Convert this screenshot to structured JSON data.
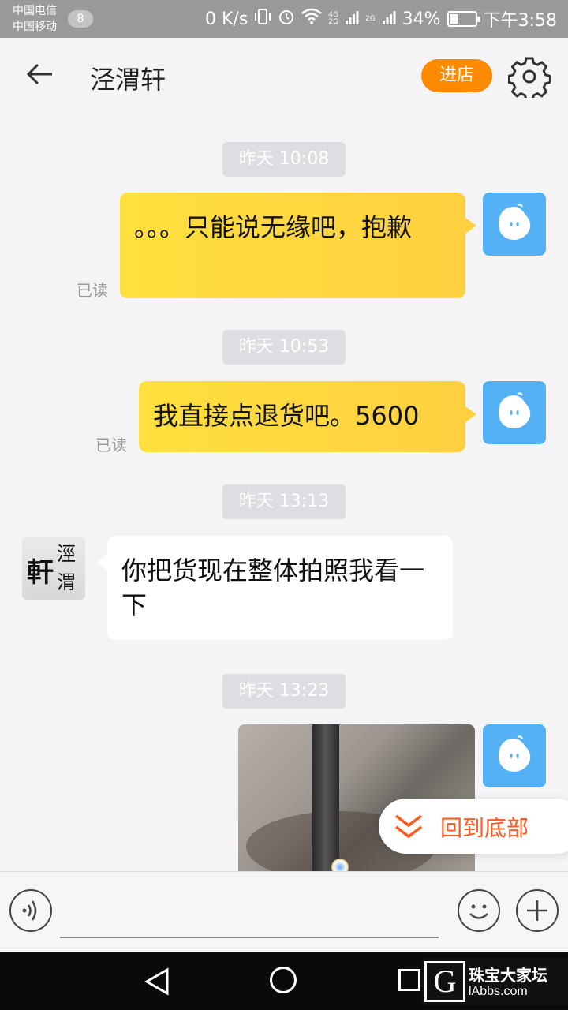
{
  "status_bar": {
    "carrier1": "中国电信",
    "carrier2": "中国移动",
    "notification_count": "8",
    "network_speed": "0 K/s",
    "net_4g": "4G",
    "net_2g_a": "2G",
    "net_2g_b": "2G",
    "battery_percent": "34%",
    "battery_level": 0.34,
    "time": "下午3:58"
  },
  "header": {
    "title": "泾渭轩",
    "enter_store_label": "进店"
  },
  "messages": [
    {
      "type": "time",
      "text": "昨天 10:08"
    },
    {
      "type": "mine",
      "text": "。。。只能说无缘吧，抱歉",
      "read": "已读"
    },
    {
      "type": "time",
      "text": "昨天 10:53"
    },
    {
      "type": "mine",
      "text": "我直接点退货吧。5600",
      "read": "已读"
    },
    {
      "type": "time",
      "text": "昨天 13:13"
    },
    {
      "type": "theirs",
      "text": "你把货现在整体拍照我看一下"
    },
    {
      "type": "time",
      "text": "昨天 13:23"
    },
    {
      "type": "mine_image"
    }
  ],
  "shop_avatar_text": {
    "line1": "軒",
    "line2": "涇",
    "line3": "渭"
  },
  "jump_bottom_label": "回到底部",
  "input": {
    "placeholder": ""
  },
  "watermark": {
    "cn": "珠宝大家坛",
    "en": "lAbbs.com"
  },
  "colors": {
    "accent": "#ff8a00",
    "bubble_mine": "#ffd23a",
    "avatar_blue": "#54b1f5",
    "jump_text": "#ff5a1e"
  }
}
